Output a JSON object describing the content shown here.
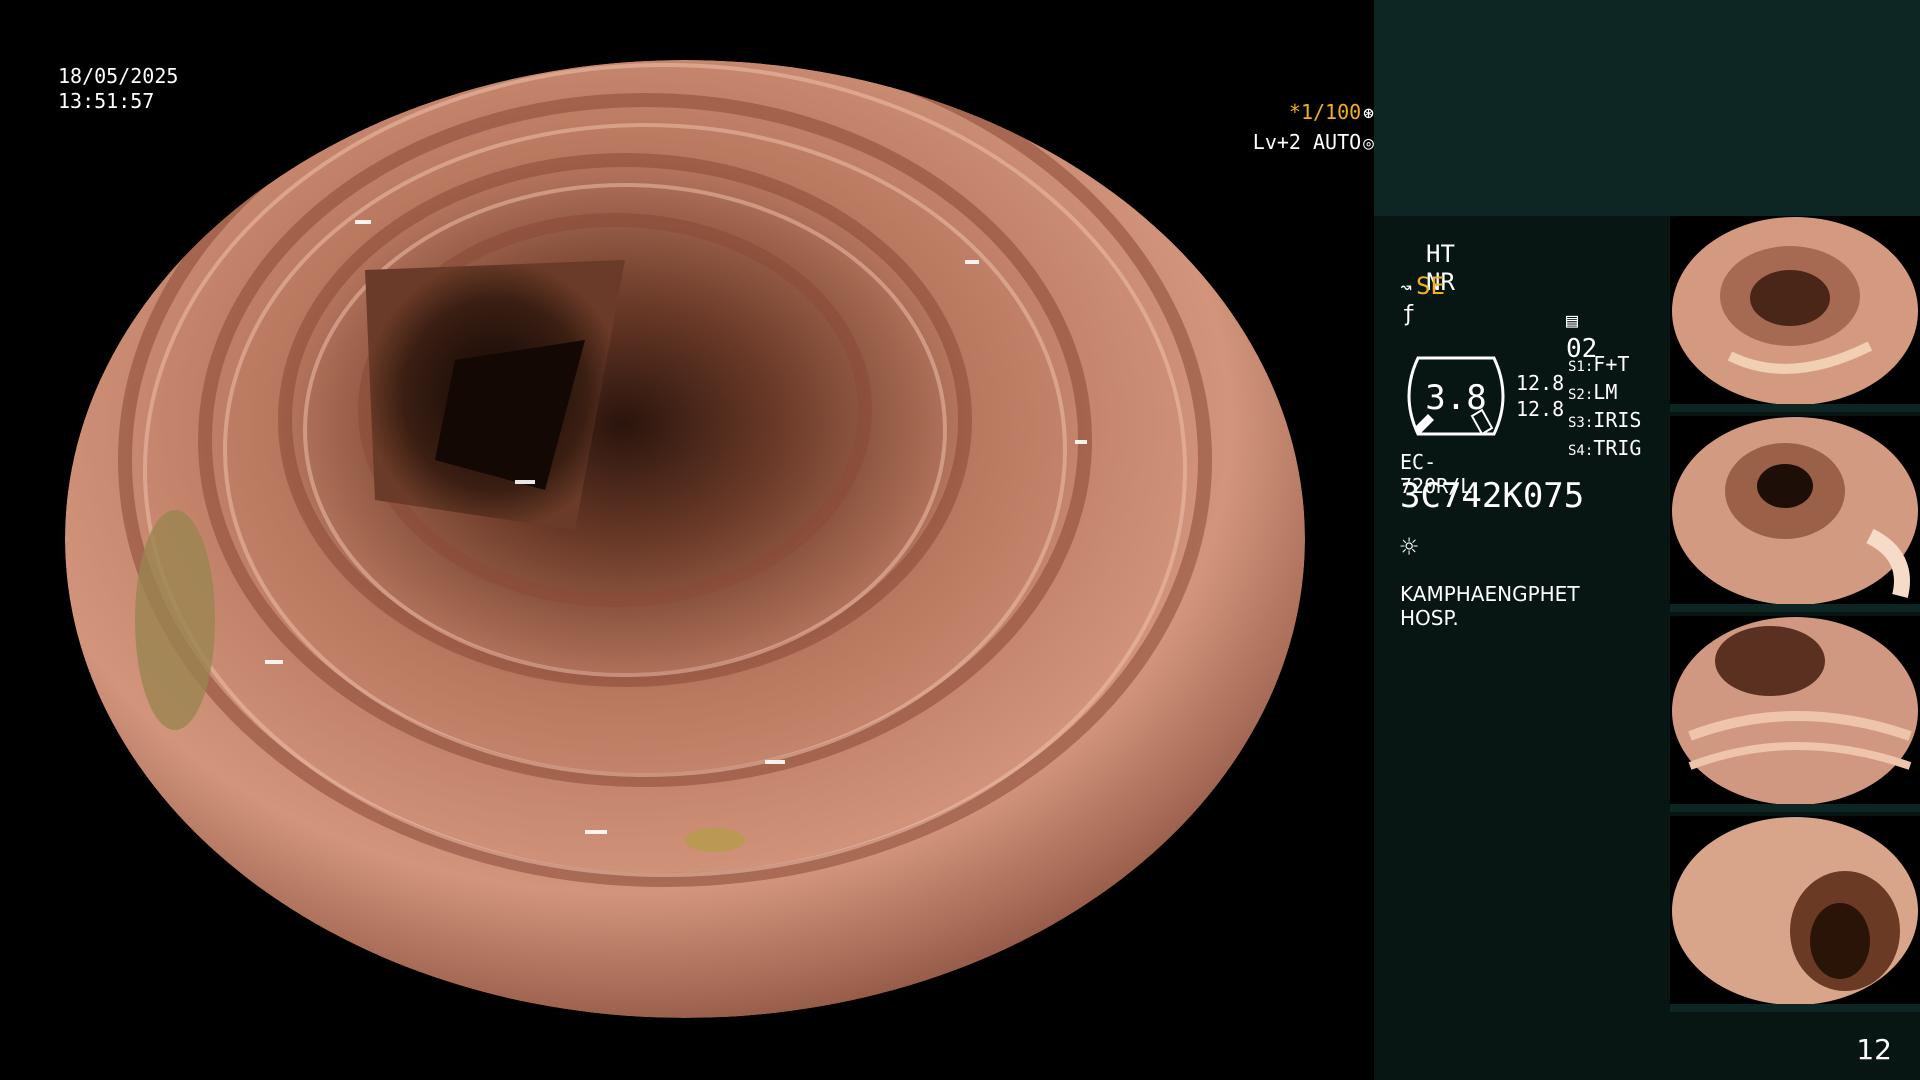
{
  "overlay": {
    "date": "18/05/2025",
    "time": "13:51:57",
    "shutter": "*1/100",
    "level": "Lv+2 AUTO"
  },
  "info": {
    "ht_nr": "HT NR",
    "se": "SE",
    "image_count": "02",
    "gauge_value": "3.8",
    "aux_values": [
      "12.8",
      "12.8"
    ],
    "switches": [
      {
        "key": "S1:",
        "label": "F+T"
      },
      {
        "key": "S2:",
        "label": "LM"
      },
      {
        "key": "S3:",
        "label": "IRIS"
      },
      {
        "key": "S4:",
        "label": "TRIG"
      }
    ],
    "scope_model": "EC-720R/L",
    "scope_serial": "3C742K075",
    "hospital": "KAMPHAENGPHET HOSP."
  },
  "page_number": "12",
  "colors": {
    "panel_top": "#0d2523",
    "panel": "#071513",
    "accent": "#f0b020",
    "mucosa": "#c8836a"
  },
  "icons": [
    "shutter-icon",
    "aperture-icon",
    "scope-icon",
    "f-icon",
    "memory-icon",
    "light-icon"
  ]
}
